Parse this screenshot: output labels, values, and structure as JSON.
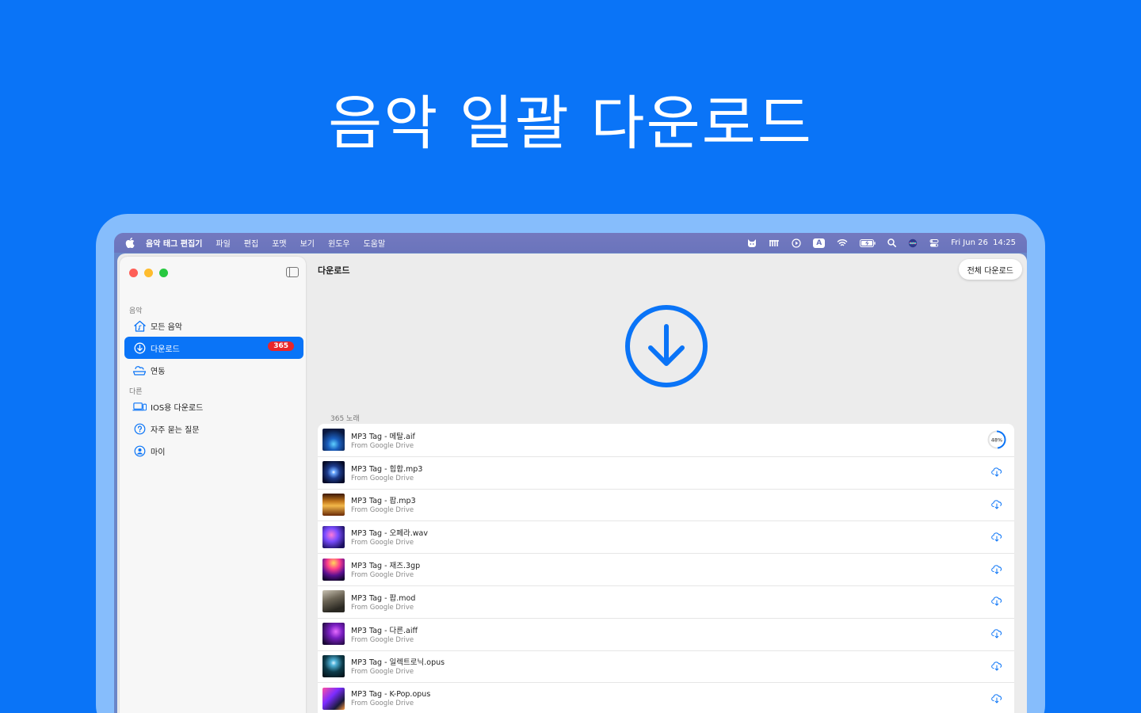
{
  "hero": {
    "title": "음악 일괄 다운로드"
  },
  "menubar": {
    "app_name": "음악 태그 편집기",
    "items": [
      "파일",
      "편집",
      "포맷",
      "보기",
      "윈도우",
      "도움말"
    ],
    "keyboard_indicator": "A",
    "datetime": "Fri Jun 26  14:25"
  },
  "sidebar": {
    "section_music": "음악",
    "section_other": "다른",
    "items": [
      {
        "label": "모든 음악",
        "icon": "house-music-icon"
      },
      {
        "label": "다운로드",
        "icon": "download-circle-icon",
        "badge": "365",
        "active": true
      },
      {
        "label": "연동",
        "icon": "cloud-drive-icon"
      },
      {
        "label": "IOS용 다운로드",
        "icon": "laptop-phone-icon"
      },
      {
        "label": "자주 묻는 질문",
        "icon": "question-circle-icon"
      },
      {
        "label": "마이",
        "icon": "person-circle-icon"
      }
    ]
  },
  "main": {
    "title": "다운로드",
    "download_all_label": "전체 다운로드",
    "count_label": "365 노래",
    "accent_color": "#0a74f7",
    "rows": [
      {
        "title": "MP3 Tag - 메탈.aif",
        "source": "From Google Drive",
        "status": "progress",
        "progress_label": "48%",
        "progress": 0.48
      },
      {
        "title": "MP3 Tag - 힙합.mp3",
        "source": "From Google Drive",
        "status": "cloud"
      },
      {
        "title": "MP3 Tag - 팝.mp3",
        "source": "From Google Drive",
        "status": "cloud"
      },
      {
        "title": "MP3 Tag - 오페라.wav",
        "source": "From Google Drive",
        "status": "cloud"
      },
      {
        "title": "MP3 Tag - 재즈.3gp",
        "source": "From Google Drive",
        "status": "cloud"
      },
      {
        "title": "MP3 Tag - 팝.mod",
        "source": "From Google Drive",
        "status": "cloud"
      },
      {
        "title": "MP3 Tag - 다른.aiff",
        "source": "From Google Drive",
        "status": "cloud"
      },
      {
        "title": "MP3 Tag - 일렉트로닉.opus",
        "source": "From Google Drive",
        "status": "cloud"
      },
      {
        "title": "MP3 Tag - K-Pop.opus",
        "source": "From Google Drive",
        "status": "cloud"
      }
    ]
  }
}
